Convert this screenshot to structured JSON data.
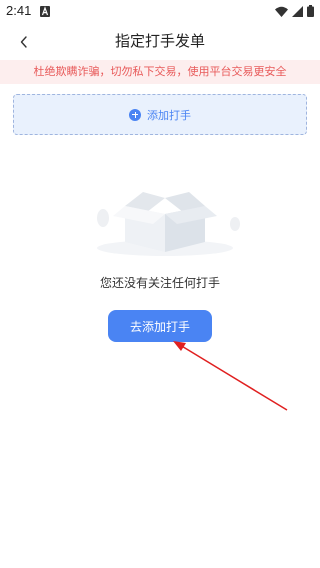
{
  "status_bar": {
    "time": "2:41",
    "app_icon": "a-letter-icon",
    "wifi_icon": "wifi-icon",
    "signal_icon": "signal-icon",
    "battery_icon": "battery-icon"
  },
  "nav": {
    "back_icon": "chevron-left-icon",
    "title": "指定打手发单"
  },
  "banner": {
    "text": "杜绝欺瞒诈骗，切勿私下交易，使用平台交易更安全"
  },
  "add_box": {
    "icon": "plus-circle-icon",
    "label": "添加打手"
  },
  "empty_state": {
    "illustration": "empty-box-icon",
    "message": "您还没有关注任何打手"
  },
  "action": {
    "button_label": "去添加打手"
  },
  "colors": {
    "accent": "#4a84f3",
    "banner_bg": "#fdeeee",
    "banner_text": "#e85a5a",
    "add_box_bg": "#e9f1fd",
    "annotation_arrow": "#e02020"
  }
}
